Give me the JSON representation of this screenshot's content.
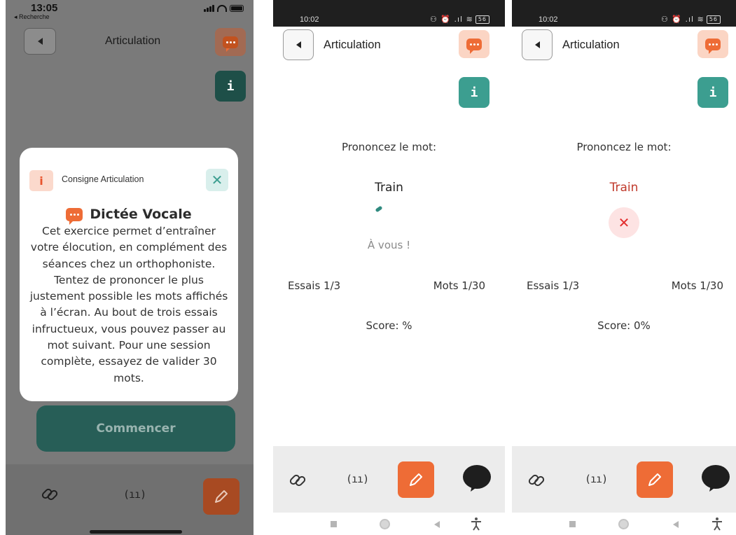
{
  "screen1": {
    "status_time": "13:05",
    "back_app_label": "◂ Recherche",
    "title": "Articulation",
    "info_glyph": "i",
    "modal": {
      "header_icon_glyph": "i",
      "header_title": "Consigne Articulation",
      "close_glyph": "✕",
      "heading": "Dictée Vocale",
      "body_lines": [
        "Cet exercice permet d’entraîner",
        "votre élocution, en complément des",
        "séances chez un orthophoniste.",
        "Tentez de prononcer le plus",
        "justement possible les mots affichés",
        "à l’écran. Au bout de trois essais",
        "infructueux, vous pouvez passer au",
        "mot suivant. Pour une session",
        "complète, essayez de valider 30",
        "mots."
      ]
    },
    "start_label": "Commencer",
    "mic_glyph": "(ıı)"
  },
  "screen2": {
    "status_time": "10:02",
    "status_icons": "⚇ ⏰ .ıl ≋",
    "battery": "56",
    "title": "Articulation",
    "info_glyph": "i",
    "prompt": "Prononcez le mot:",
    "word": "Train",
    "your_turn": "À vous !",
    "attempts": "Essais 1/3",
    "words": "Mots 1/30",
    "score": "Score: %",
    "mic_glyph": "(ıı)",
    "nav_accessibility_glyph": "🕴"
  },
  "screen3": {
    "status_time": "10:02",
    "status_icons": "⚇ ⏰ .ıl ≋",
    "battery": "56",
    "title": "Articulation",
    "info_glyph": "i",
    "prompt": "Prononcez le mot:",
    "word": "Train",
    "fail_glyph": "✕",
    "attempts": "Essais 1/3",
    "words": "Mots 1/30",
    "score": "Score: 0%",
    "mic_glyph": "(ıı)",
    "nav_accessibility_glyph": "🕴"
  },
  "colors": {
    "accent_orange": "#ee6c36",
    "accent_teal": "#3c9e90",
    "error_red": "#e22d2d"
  },
  "icons": [
    "back-icon",
    "chat-icon",
    "info-icon",
    "link-icon",
    "mic-icon",
    "pencil-icon",
    "speech-bubble-icon",
    "close-icon"
  ]
}
